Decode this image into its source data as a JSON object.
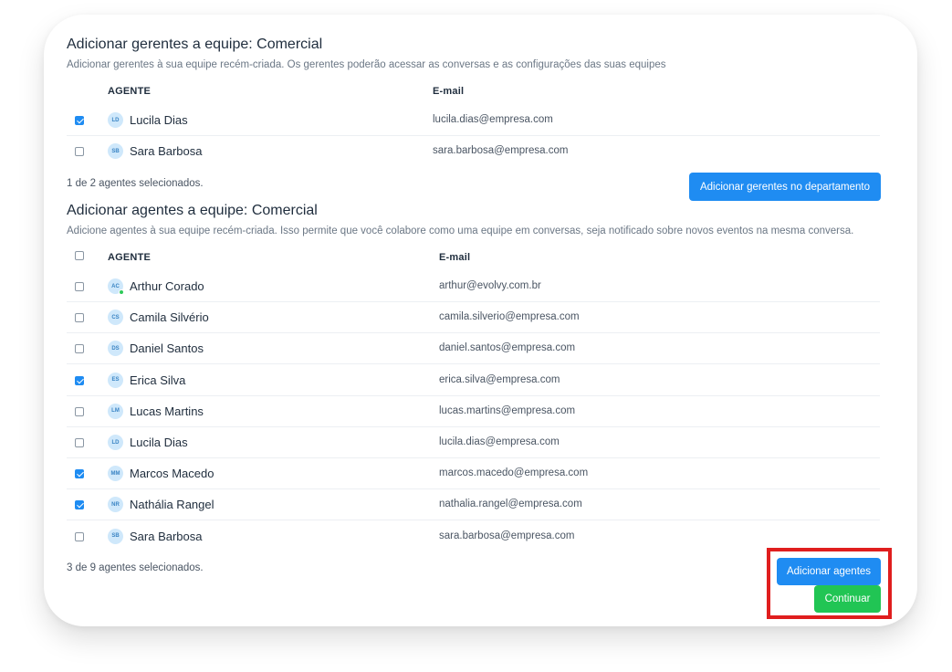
{
  "managers": {
    "title": "Adicionar gerentes a equipe: Comercial",
    "description": "Adicionar gerentes à sua equipe recém-criada. Os gerentes poderão acessar as conversas e as configurações das suas equipes",
    "columns": {
      "agent": "AGENTE",
      "email": "E-mail"
    },
    "rows": [
      {
        "initials": "LD",
        "name": "Lucila Dias",
        "email": "lucila.dias@empresa.com",
        "checked": true
      },
      {
        "initials": "SB",
        "name": "Sara Barbosa",
        "email": "sara.barbosa@empresa.com",
        "checked": false
      }
    ],
    "count_text": "1 de 2 agentes selecionados.",
    "button_label": "Adicionar gerentes no departamento"
  },
  "agents": {
    "title": "Adicionar agentes a equipe: Comercial",
    "description": "Adicione agentes à sua equipe recém-criada. Isso permite que você colabore como uma equipe em conversas, seja notificado sobre novos eventos na mesma conversa.",
    "columns": {
      "agent": "AGENTE",
      "email": "E-mail"
    },
    "rows": [
      {
        "initials": "AC",
        "name": "Arthur Corado",
        "email": "arthur@evolvy.com.br",
        "checked": false,
        "online": true
      },
      {
        "initials": "CS",
        "name": "Camila Silvério",
        "email": "camila.silverio@empresa.com",
        "checked": false
      },
      {
        "initials": "DS",
        "name": "Daniel Santos",
        "email": "daniel.santos@empresa.com",
        "checked": false
      },
      {
        "initials": "ES",
        "name": "Erica Silva",
        "email": "erica.silva@empresa.com",
        "checked": true
      },
      {
        "initials": "LM",
        "name": "Lucas Martins",
        "email": "lucas.martins@empresa.com",
        "checked": false
      },
      {
        "initials": "LD",
        "name": "Lucila Dias",
        "email": "lucila.dias@empresa.com",
        "checked": false
      },
      {
        "initials": "MM",
        "name": "Marcos Macedo",
        "email": "marcos.macedo@empresa.com",
        "checked": true
      },
      {
        "initials": "NR",
        "name": "Nathália Rangel",
        "email": "nathalia.rangel@empresa.com",
        "checked": true
      },
      {
        "initials": "SB",
        "name": "Sara Barbosa",
        "email": "sara.barbosa@empresa.com",
        "checked": false
      }
    ],
    "count_text": "3 de 9 agentes selecionados.",
    "add_button_label": "Adicionar agentes",
    "continue_button_label": "Continuar"
  },
  "colors": {
    "primary": "#1f8cf2",
    "success": "#21c554",
    "highlight": "#e01e1e",
    "avatar_bg": "#cfe8fb",
    "online": "#2fc95a"
  }
}
